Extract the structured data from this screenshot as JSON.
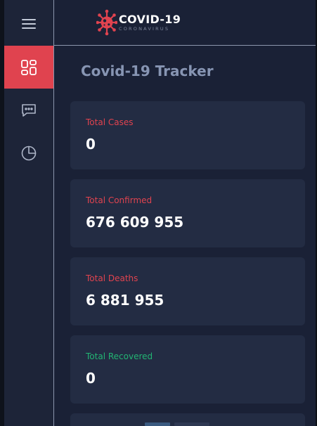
{
  "app": {
    "logo_title": "COVID-19",
    "logo_subtitle": "CORONAVIRUS",
    "page_title": "Covid-19 Tracker"
  },
  "sidebar": {
    "items": [
      {
        "name": "dashboard",
        "icon": "dashboard-grid-icon",
        "active": true
      },
      {
        "name": "messages",
        "icon": "chat-bubble-icon",
        "active": false
      },
      {
        "name": "chart",
        "icon": "pie-chart-icon",
        "active": false
      }
    ]
  },
  "colors": {
    "accent": "#e0434f",
    "recovered": "#22b573",
    "background": "#1a2136",
    "card": "#232c43",
    "title": "#8795b3"
  },
  "stats": [
    {
      "label": "Total Cases",
      "value": "0",
      "color": "#e0434f"
    },
    {
      "label": "Total Confirmed",
      "value": "676 609 955",
      "color": "#e0434f"
    },
    {
      "label": "Total Deaths",
      "value": "6 881 955",
      "color": "#e0434f"
    },
    {
      "label": "Total Recovered",
      "value": "0",
      "color": "#22b573"
    }
  ]
}
